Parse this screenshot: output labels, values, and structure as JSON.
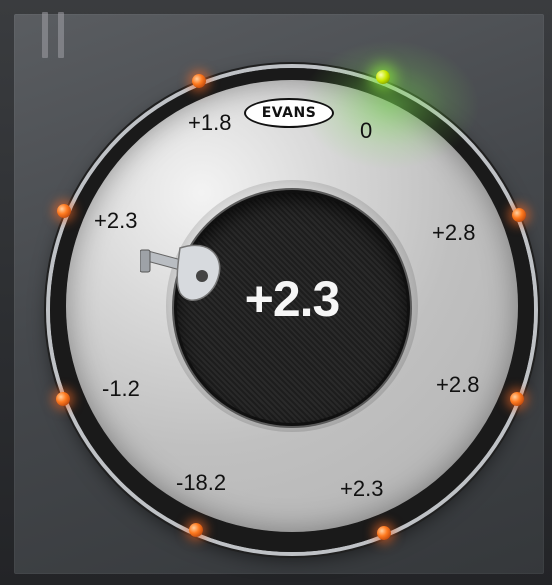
{
  "pause_icon": "pause-icon",
  "logo": {
    "text": "EVANS"
  },
  "center": {
    "value": "+2.3"
  },
  "lugs": [
    {
      "id": "lug-top-left",
      "label": "+1.8",
      "status": "orange"
    },
    {
      "id": "lug-top-right",
      "label": "0",
      "status": "green"
    },
    {
      "id": "lug-upper-left",
      "label": "+2.3",
      "status": "orange"
    },
    {
      "id": "lug-upper-right",
      "label": "+2.8",
      "status": "orange"
    },
    {
      "id": "lug-lower-left",
      "label": "-1.2",
      "status": "orange"
    },
    {
      "id": "lug-lower-right",
      "label": "+2.8",
      "status": "orange"
    },
    {
      "id": "lug-bottom-left",
      "label": "-18.2",
      "status": "orange"
    },
    {
      "id": "lug-bottom-right",
      "label": "+2.3",
      "status": "orange"
    }
  ],
  "colors": {
    "accent_orange": "#ff7a1f",
    "accent_green": "#c8e800",
    "center_text": "#f6f6f6"
  }
}
